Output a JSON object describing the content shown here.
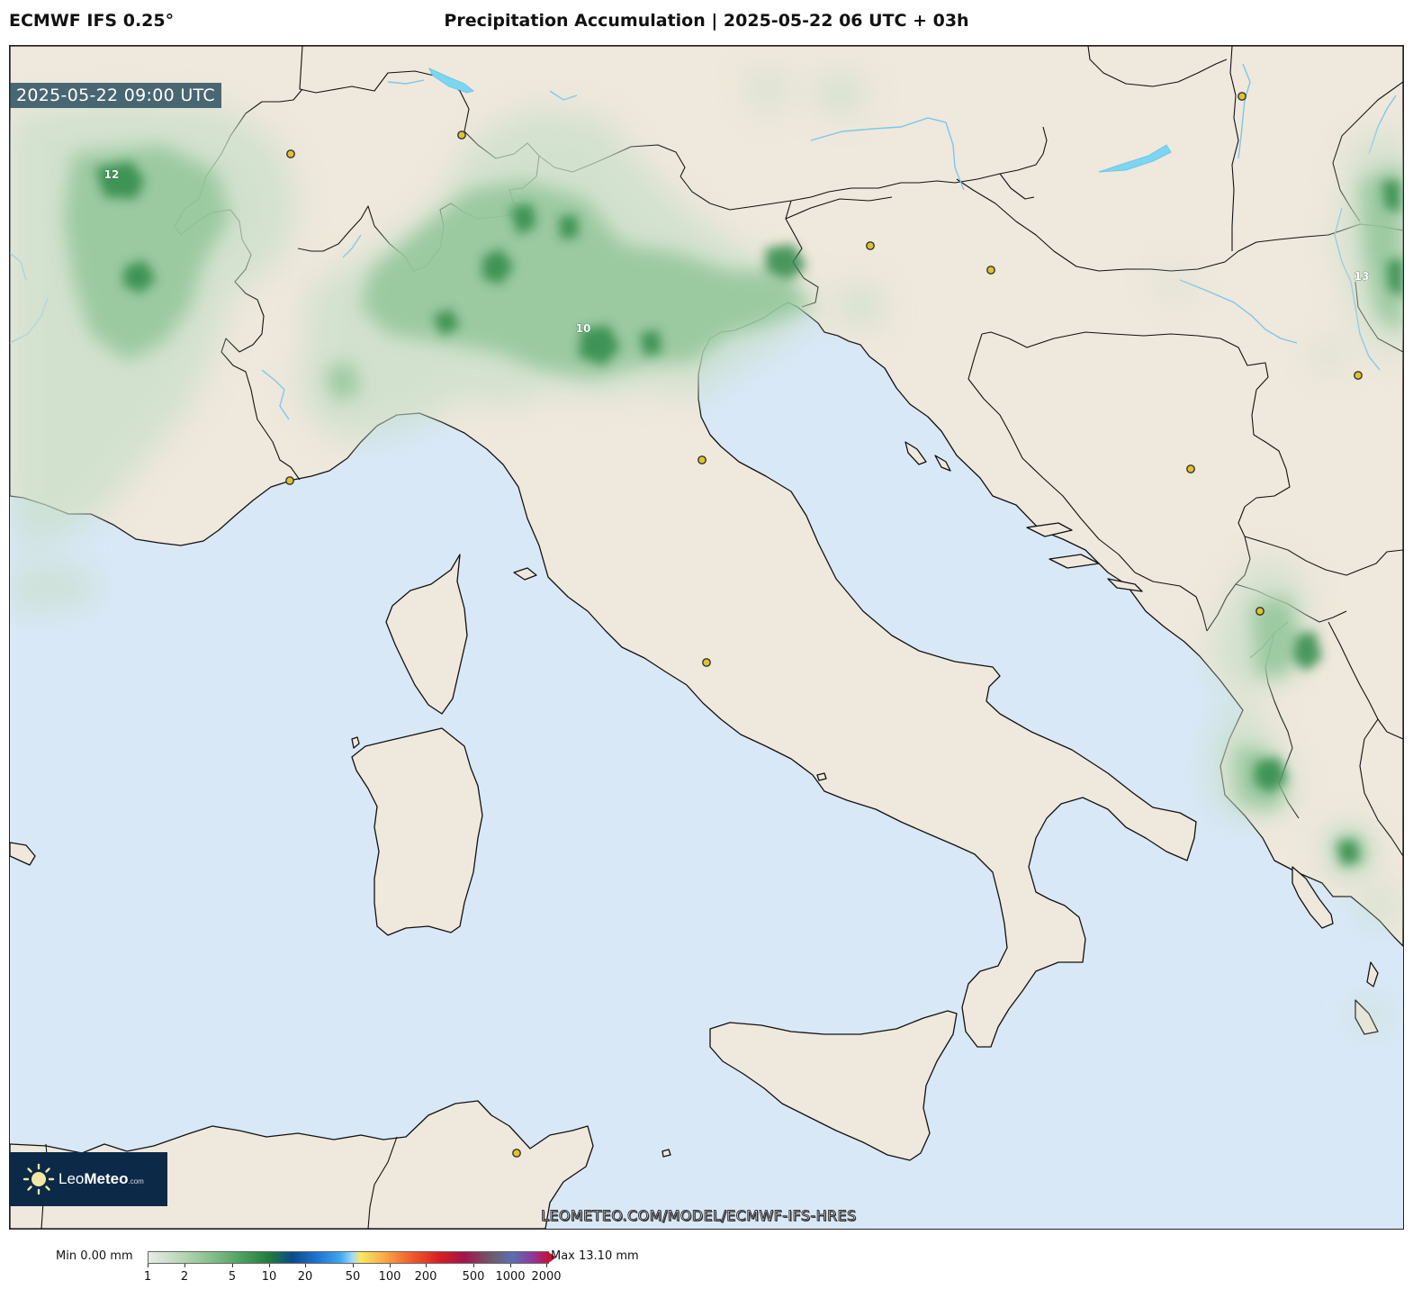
{
  "header": {
    "model": "ECMWF IFS 0.25°",
    "title": "Precipitation Accumulation | 2025-05-22 06 UTC + 03h"
  },
  "map": {
    "valid_time": "2025-05-22 09:00 UTC",
    "max_labels": [
      "12",
      "10",
      "13"
    ],
    "source_url": "LEOMETEO.COM/MODEL/ECMWF-IFS-HRES",
    "logo": {
      "brand": "Leo",
      "brand_bold": "Meteo",
      "suffix": ".com"
    },
    "colors": {
      "sea": "#d9e8f7",
      "land": "#efe8dc",
      "coast": "#111111",
      "rivers": "#7cc7ea",
      "precip_light": "#c9dfca",
      "precip_heavy": "#1f7a3c"
    },
    "city_marker_icon": "city-dot-icon"
  },
  "colorbar": {
    "min_label": "Min 0.00 mm",
    "max_label": "Max 13.10 mm",
    "ticks": [
      "1",
      "2",
      "5",
      "10",
      "20",
      "50",
      "100",
      "200",
      "500",
      "1000",
      "2000"
    ],
    "unit": "mm"
  }
}
